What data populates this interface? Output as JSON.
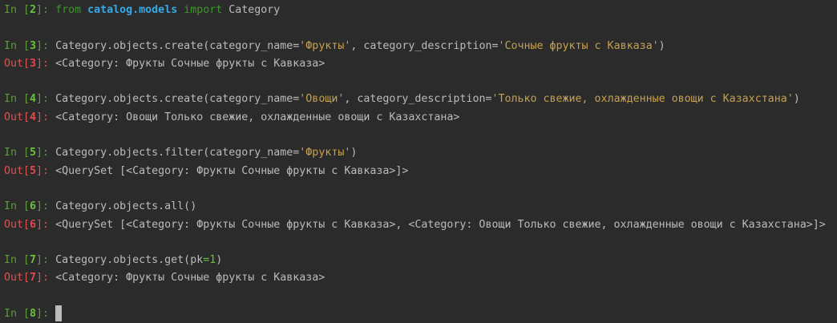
{
  "cells": [
    {
      "in": "2",
      "code": [
        [
          "kw",
          "from"
        ],
        [
          "t",
          " "
        ],
        [
          "mod",
          "catalog.models"
        ],
        [
          "t",
          " "
        ],
        [
          "kw",
          "import"
        ],
        [
          "t",
          " Category"
        ]
      ]
    },
    {
      "in": "3",
      "code": [
        [
          "t",
          "Category.objects.create(category_name="
        ],
        [
          "str",
          "'Фрукты'"
        ],
        [
          "t",
          ", category_description="
        ],
        [
          "str",
          "'Сочные фрукты с Кавказа'"
        ],
        [
          "t",
          ")"
        ]
      ],
      "out": "<Category: Фрукты Сочные фрукты с Кавказа>"
    },
    {
      "in": "4",
      "code": [
        [
          "t",
          "Category.objects.create(category_name="
        ],
        [
          "str",
          "'Овощи'"
        ],
        [
          "t",
          ", category_description="
        ],
        [
          "str",
          "'Только свежие, охлажденные овощи с Казахстана'"
        ],
        [
          "t",
          ")"
        ]
      ],
      "out": "<Category: Овощи Только свежие, охлажденные овощи с Казахстана>"
    },
    {
      "in": "5",
      "code": [
        [
          "t",
          "Category.objects.filter(category_name="
        ],
        [
          "str",
          "'Фрукты'"
        ],
        [
          "t",
          ")"
        ]
      ],
      "out": "<QuerySet [<Category: Фрукты Сочные фрукты с Кавказа>]>"
    },
    {
      "in": "6",
      "code": [
        [
          "t",
          "Category.objects.all()"
        ]
      ],
      "out": "<QuerySet [<Category: Фрукты Сочные фрукты с Кавказа>, <Category: Овощи Только свежие, охлажденные овощи с Казахстана>]>"
    },
    {
      "in": "7",
      "code": [
        [
          "t",
          "Category.objects.get(pk"
        ],
        [
          "num",
          "="
        ],
        [
          "num",
          "1"
        ],
        [
          "t",
          ")"
        ]
      ],
      "out": "<Category: Фрукты Сочные фрукты с Кавказа>"
    },
    {
      "in": "8",
      "code": [],
      "active": true
    }
  ],
  "prompt": {
    "in_label": "In ",
    "out_label": "Out",
    "close": "]: "
  }
}
